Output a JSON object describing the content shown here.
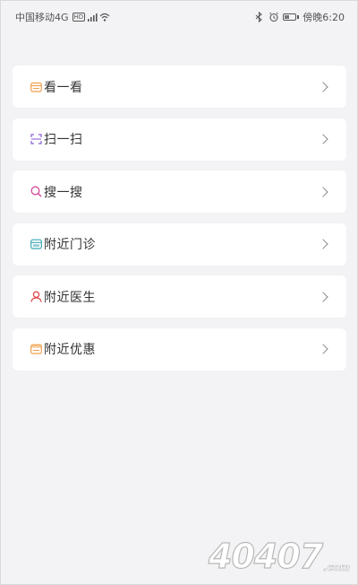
{
  "status_bar": {
    "carrier": "中国移动4G",
    "network_badge": "HD",
    "signal_label": "⁴ᴳ",
    "time": "傍晚6:20",
    "icons": [
      "hd-icon",
      "signal-icon",
      "wifi-icon",
      "bluetooth-icon",
      "alarm-icon",
      "battery-icon"
    ]
  },
  "menu": {
    "items": [
      {
        "label": "看一看",
        "icon": "browse-icon",
        "color": "#f0a04b"
      },
      {
        "label": "扫一扫",
        "icon": "scan-icon",
        "color": "#8b5fd6"
      },
      {
        "label": "搜一搜",
        "icon": "search-icon",
        "color": "#d8499a"
      },
      {
        "label": "附近门诊",
        "icon": "clinic-icon",
        "color": "#3aa8b4"
      },
      {
        "label": "附近医生",
        "icon": "doctor-icon",
        "color": "#e04b4b"
      },
      {
        "label": "附近优惠",
        "icon": "discount-icon",
        "color": "#f0a04b"
      }
    ]
  },
  "watermark": {
    "text": "40407",
    "suffix": ".com"
  }
}
